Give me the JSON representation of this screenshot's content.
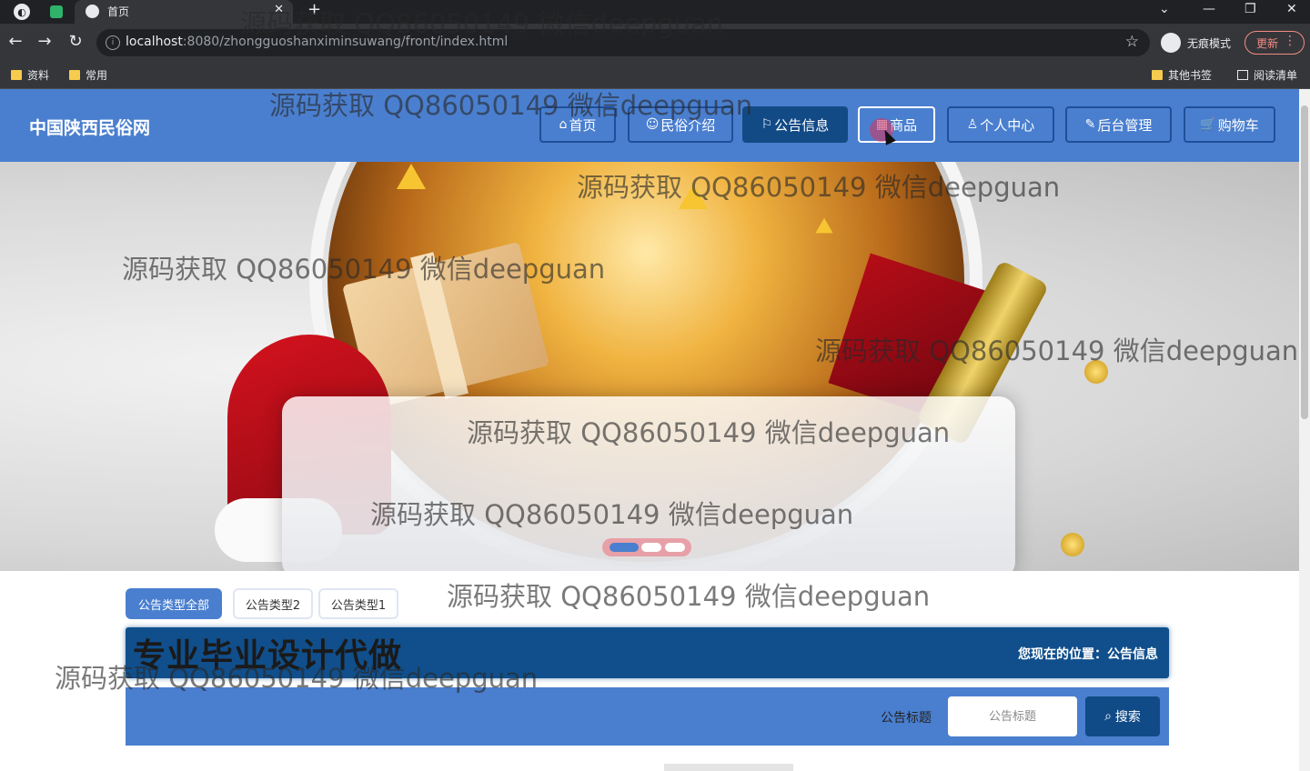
{
  "browser": {
    "tab_title": "首页",
    "new_tab_glyph": "+",
    "url_host": "localhost",
    "url_path": ":8080/zhongguoshanximinsuwang/front/index.html",
    "incognito_label": "无痕模式",
    "update_label": "更新",
    "bookmarks": [
      "资料",
      "常用"
    ],
    "bookmarks_right": [
      "其他书签",
      "阅读清单"
    ]
  },
  "site": {
    "title": "中国陕西民俗网",
    "menu": [
      {
        "icon": "⌂",
        "label": "首页"
      },
      {
        "icon": "☺",
        "label": "民俗介绍"
      },
      {
        "icon": "⚐",
        "label": "公告信息"
      },
      {
        "icon": "▦",
        "label": "商品"
      },
      {
        "icon": "♙",
        "label": "个人中心"
      },
      {
        "icon": "✎",
        "label": "后台管理"
      },
      {
        "icon": "🛒",
        "label": "购物车"
      }
    ],
    "active_menu": "公告信息"
  },
  "carousel": {
    "slides": 3,
    "active_index": 0
  },
  "categories": [
    "公告类型全部",
    "公告类型2",
    "公告类型1"
  ],
  "breadcrumb": {
    "promo": "专业毕业设计代做",
    "text": "您现在的位置：公告信息"
  },
  "search": {
    "label": "公告标题",
    "placeholder": "公告标题",
    "button": "搜索"
  },
  "watermark": "源码获取 QQ86050149 微信deepguan",
  "colors": {
    "header_blue": "#4a7fcf",
    "active_menu": "#124a86",
    "crumb_bar": "#104f8c",
    "search_btn": "#114b87"
  }
}
